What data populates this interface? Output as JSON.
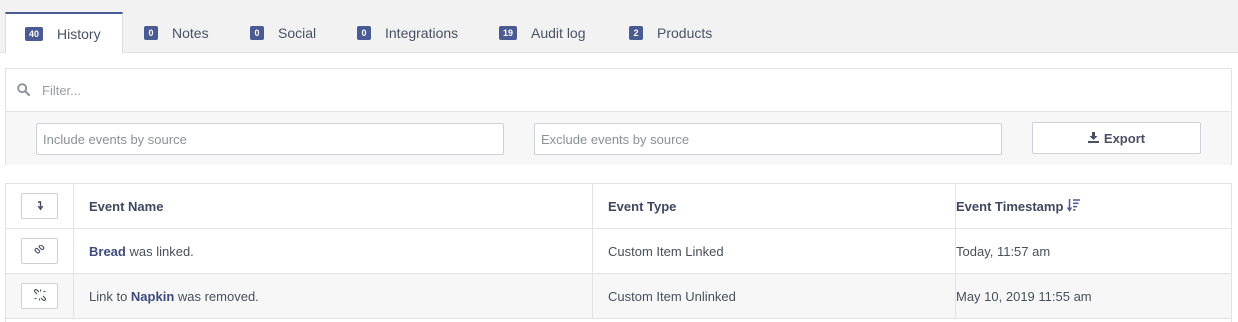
{
  "tabs": [
    {
      "count": "40",
      "label": "History",
      "active": true
    },
    {
      "count": "0",
      "label": "Notes"
    },
    {
      "count": "0",
      "label": "Social"
    },
    {
      "count": "0",
      "label": "Integrations"
    },
    {
      "count": "19",
      "label": "Audit log"
    },
    {
      "count": "2",
      "label": "Products"
    }
  ],
  "filter": {
    "placeholder": "Filter...",
    "value": ""
  },
  "sources": {
    "include_placeholder": "Include events by source",
    "exclude_placeholder": "Exclude events by source",
    "export_label": "Export"
  },
  "table": {
    "columns": [
      "Event Name",
      "Event Type",
      "Event Timestamp"
    ],
    "rows": [
      {
        "icon": "link-icon",
        "name_strong": "Bread",
        "name_rest": " was linked.",
        "type": "Custom Item Linked",
        "timestamp": "Today, 11:57 am"
      },
      {
        "icon": "unlink-icon",
        "name_prefix": "Link to ",
        "name_strong": "Napkin",
        "name_rest": " was removed.",
        "type": "Custom Item Unlinked",
        "timestamp": "May 10, 2019 11:55 am"
      }
    ]
  },
  "colors": {
    "accent": "#4a5a93",
    "tab_bar_bg": "#f2f2f3",
    "border": "#e3e3e6"
  }
}
